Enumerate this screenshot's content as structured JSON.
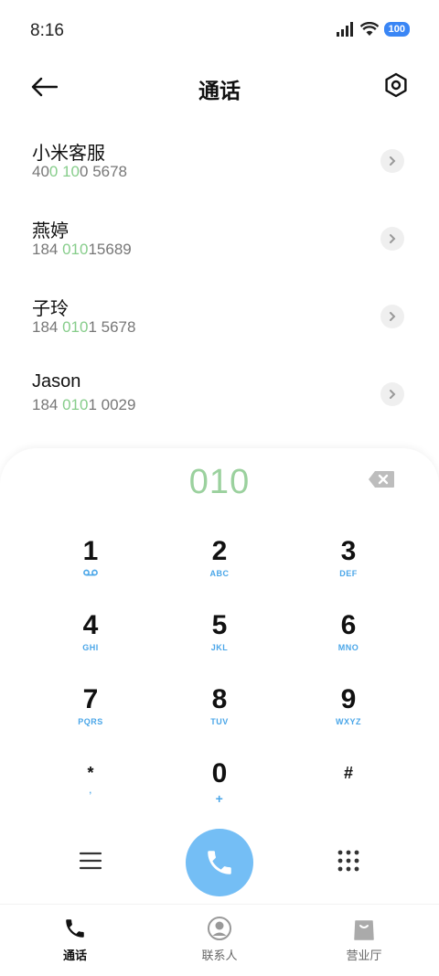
{
  "status_bar": {
    "time": "8:16",
    "battery": "100"
  },
  "header": {
    "title": "通话"
  },
  "results": [
    {
      "name": "小米客服",
      "number_parts": [
        "40",
        "0 10",
        "0 5678"
      ]
    },
    {
      "name": "燕婷",
      "number_parts": [
        "184 ",
        "010",
        "15689"
      ]
    },
    {
      "name": "子玲",
      "number_parts": [
        "184 ",
        "010",
        "1 5678"
      ]
    },
    {
      "name": "Jason",
      "number_parts": [
        "184 ",
        "010",
        "1 0029"
      ]
    }
  ],
  "dialer": {
    "input": "010",
    "keys": [
      {
        "digit": "1",
        "letters": ""
      },
      {
        "digit": "2",
        "letters": "ABC"
      },
      {
        "digit": "3",
        "letters": "DEF"
      },
      {
        "digit": "4",
        "letters": "GHI"
      },
      {
        "digit": "5",
        "letters": "JKL"
      },
      {
        "digit": "6",
        "letters": "MNO"
      },
      {
        "digit": "7",
        "letters": "PQRS"
      },
      {
        "digit": "8",
        "letters": "TUV"
      },
      {
        "digit": "9",
        "letters": "WXYZ"
      },
      {
        "digit": "*",
        "letters": ","
      },
      {
        "digit": "0",
        "letters": "+"
      },
      {
        "digit": "#",
        "letters": ""
      }
    ]
  },
  "bottom_nav": [
    {
      "label": "通话",
      "icon": "phone-icon",
      "active": true
    },
    {
      "label": "联系人",
      "icon": "contacts-icon",
      "active": false
    },
    {
      "label": "营业厅",
      "icon": "shopping-bag-icon",
      "active": false
    }
  ],
  "colors": {
    "accent": "#74bef5",
    "highlight": "#87cd8b",
    "key_letters": "#4aa6e8"
  }
}
